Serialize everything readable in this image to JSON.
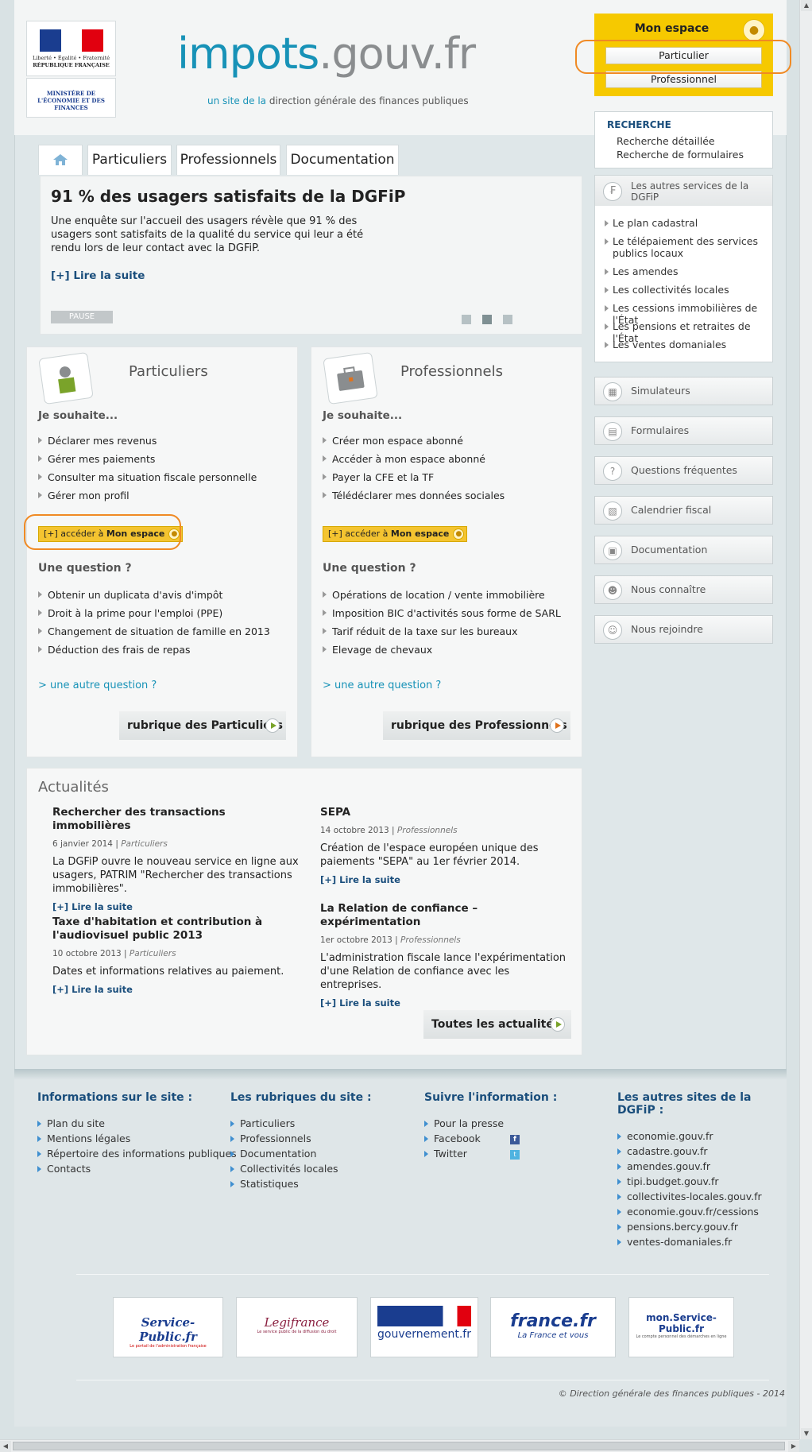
{
  "header": {
    "rf_line1": "Liberté • Égalité • Fraternité",
    "rf_line2": "RÉPUBLIQUE FRANÇAISE",
    "ministry": "MINISTÈRE DE L'ÉCONOMIE ET DES FINANCES",
    "site_part1": "impots",
    "site_part2": ".gouv.fr",
    "sub_hl": "un site de la",
    "sub_rest": " direction générale des finances publiques"
  },
  "mon_espace": {
    "title": "Mon espace",
    "buttons": [
      "Particulier",
      "Professionnel"
    ]
  },
  "search": {
    "heading": "RECHERCHE",
    "links": [
      "Recherche détaillée",
      "Recherche de formulaires"
    ]
  },
  "services": {
    "heading": "Les autres services de la DGFiP",
    "items": [
      "Le plan cadastral",
      "Le télépaiement des services publics locaux",
      "Les amendes",
      "Les collectivités locales",
      "Les cessions immobilières de l'État",
      "Les pensions et retraites de l'État",
      "Les ventes domaniales"
    ]
  },
  "side_buttons": [
    "Simulateurs",
    "Formulaires",
    "Questions fréquentes",
    "Calendrier fiscal",
    "Documentation",
    "Nous connaître",
    "Nous rejoindre"
  ],
  "tabs": [
    "Particuliers",
    "Professionnels",
    "Documentation"
  ],
  "slider": {
    "title": "91 % des usagers satisfaits de la DGFiP",
    "text": "Une enquête sur l'accueil des usagers révèle que 91 % des usagers sont satisfaits de la qualité du service qui leur a été rendu lors de leur contact avec la DGFiP.",
    "more": "[+] Lire la suite",
    "pause": "PAUSE"
  },
  "particuliers": {
    "title": "Particuliers",
    "souhaite": "Je souhaite...",
    "items": [
      "Déclarer mes revenus",
      "Gérer mes paiements",
      "Consulter ma situation fiscale personnelle",
      "Gérer mon profil"
    ],
    "access_prefix": "[+] accéder à ",
    "access_bold": "Mon espace",
    "question": "Une question ?",
    "questions": [
      "Obtenir un duplicata d'avis d'impôt",
      "Droit à la prime pour l'emploi (PPE)",
      "Changement de situation de famille en 2013",
      "Déduction des frais de repas"
    ],
    "other": "> une autre question ?",
    "rubrique": "rubrique des Particuliers"
  },
  "professionnels": {
    "title": "Professionnels",
    "souhaite": "Je souhaite...",
    "items": [
      "Créer mon espace abonné",
      "Accéder à mon espace abonné",
      "Payer la CFE et la TF",
      "Télédéclarer mes données sociales"
    ],
    "access_prefix": "[+] accéder à ",
    "access_bold": "Mon espace",
    "question": "Une question ?",
    "questions": [
      "Opérations de location / vente immobilière",
      "Imposition BIC d'activités sous forme de SARL",
      "Tarif réduit de la taxe sur les bureaux",
      "Elevage de chevaux"
    ],
    "other": "> une autre question ?",
    "rubrique": "rubrique des Professionnels"
  },
  "actualites": {
    "heading": "Actualités",
    "news": [
      {
        "title": "Rechercher des transactions immobilières",
        "date": "6 janvier 2014 | ",
        "cat": "Particuliers",
        "body": "La DGFiP ouvre le nouveau service en ligne aux usagers, PATRIM \"Rechercher des transactions immobilières\".",
        "more": "[+] Lire la suite"
      },
      {
        "title": "Taxe d'habitation et contribution à l'audiovisuel public 2013",
        "date": "10 octobre 2013 | ",
        "cat": "Particuliers",
        "body": "Dates et informations relatives au paiement.",
        "more": "[+] Lire la suite"
      },
      {
        "title": "SEPA",
        "date": "14 octobre 2013 | ",
        "cat": "Professionnels",
        "body": "Création de l'espace européen unique des paiements \"SEPA\" au 1er février 2014.",
        "more": "[+] Lire la suite"
      },
      {
        "title": "La Relation de confiance – expérimentation",
        "date": "1er octobre 2013 | ",
        "cat": "Professionnels",
        "body": "L'administration fiscale lance l'expérimentation d'une Relation de confiance avec les entreprises.",
        "more": "[+] Lire la suite"
      }
    ],
    "all": "Toutes les actualités"
  },
  "footer": {
    "cols": [
      {
        "heading": "Informations sur le site :",
        "items": [
          "Plan du site",
          "Mentions légales",
          "Répertoire des informations publiques",
          "Contacts"
        ]
      },
      {
        "heading": "Les rubriques du site :",
        "items": [
          "Particuliers",
          "Professionnels",
          "Documentation",
          "Collectivités locales",
          "Statistiques"
        ]
      },
      {
        "heading": "Suivre l'information :",
        "items": [
          "Pour la presse",
          "Facebook",
          "Twitter"
        ]
      },
      {
        "heading": "Les autres sites de la DGFiP :",
        "items": [
          "economie.gouv.fr",
          "cadastre.gouv.fr",
          "amendes.gouv.fr",
          "tipi.budget.gouv.fr",
          "collectivites-locales.gouv.fr",
          "economie.gouv.fr/cessions",
          "pensions.bercy.gouv.fr",
          "ventes-domaniales.fr"
        ]
      }
    ],
    "partners": [
      {
        "name": "Service-Public.fr",
        "sub": "Le portail de l'administration française"
      },
      {
        "name": "Legifrance",
        "sub": "Le service public de la diffusion du droit"
      },
      {
        "name": "gouvernement.fr"
      },
      {
        "name": "france.fr",
        "sub": "La France et vous"
      },
      {
        "name": "mon.Service-Public.fr",
        "sub": "Le compte personnel des démarches en ligne"
      }
    ],
    "copyright": "© Direction générale des finances publiques - 2014"
  },
  "colors": {
    "brand_blue": "#1792b7",
    "link_navy": "#1a4e7c",
    "mon_espace_yellow": "#f6c900",
    "highlight_orange": "#f08a24"
  }
}
